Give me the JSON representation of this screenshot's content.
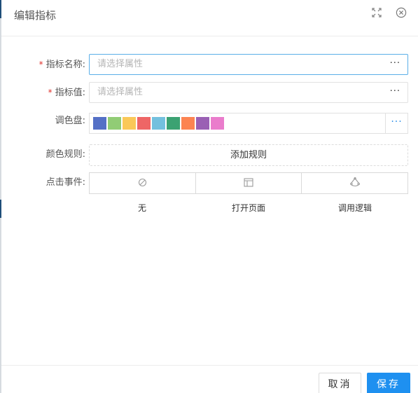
{
  "dialog": {
    "title": "编辑指标"
  },
  "form": {
    "indicator_name": {
      "label": "指标名称:",
      "required_mark": "*",
      "placeholder": "请选择属性",
      "more": "···"
    },
    "indicator_value": {
      "label": "指标值:",
      "required_mark": "*",
      "placeholder": "请选择属性",
      "more": "···"
    },
    "palette": {
      "label": "调色盘:",
      "more": "···",
      "colors": [
        "#5470c6",
        "#91cc75",
        "#fac858",
        "#ee6666",
        "#73c0de",
        "#3ba272",
        "#fc8452",
        "#9a60b4",
        "#ea7ccc"
      ]
    },
    "color_rules": {
      "label": "颜色规则:",
      "add_label": "添加规则"
    },
    "click_event": {
      "label": "点击事件:",
      "options": [
        {
          "icon": "ban-icon",
          "label": "无"
        },
        {
          "icon": "page-layout-icon",
          "label": "打开页面"
        },
        {
          "icon": "logic-icon",
          "label": "调用逻辑"
        }
      ]
    }
  },
  "footer": {
    "cancel_label": "取消",
    "save_label": "保存"
  },
  "colors": {
    "primary": "#1e90f0",
    "required": "#e0322c",
    "focus_border": "#5aaee8"
  },
  "icons": {
    "fullscreen": "fullscreen-icon",
    "close": "close-circle-icon"
  }
}
